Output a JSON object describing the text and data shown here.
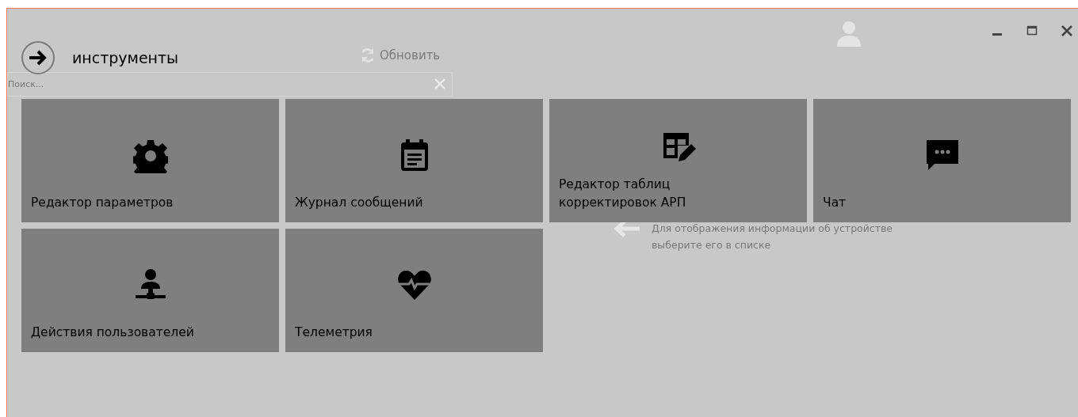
{
  "window": {
    "controls": [
      {
        "kind": "minimize"
      },
      {
        "kind": "maximize"
      },
      {
        "kind": "close"
      }
    ]
  },
  "objects_panel": {
    "refresh_label": "Обновить",
    "search": {
      "placeholder": "Поиск..."
    }
  },
  "details_hint": "Для отображения информации об устройстве выберите его в списке",
  "tools_panel": {
    "title": "инструменты",
    "tiles": [
      {
        "label": "Редактор параметров",
        "kind": "settings"
      },
      {
        "label": "Журнал сообщений",
        "kind": "log"
      },
      {
        "label": "Редактор таблиц\nкорректировок АРП",
        "kind": "table-edit"
      },
      {
        "label": "Чат",
        "kind": "chat"
      },
      {
        "label": "Действия пользователей",
        "kind": "user-actions"
      },
      {
        "label": "Телеметрия",
        "kind": "telemetry"
      }
    ]
  }
}
